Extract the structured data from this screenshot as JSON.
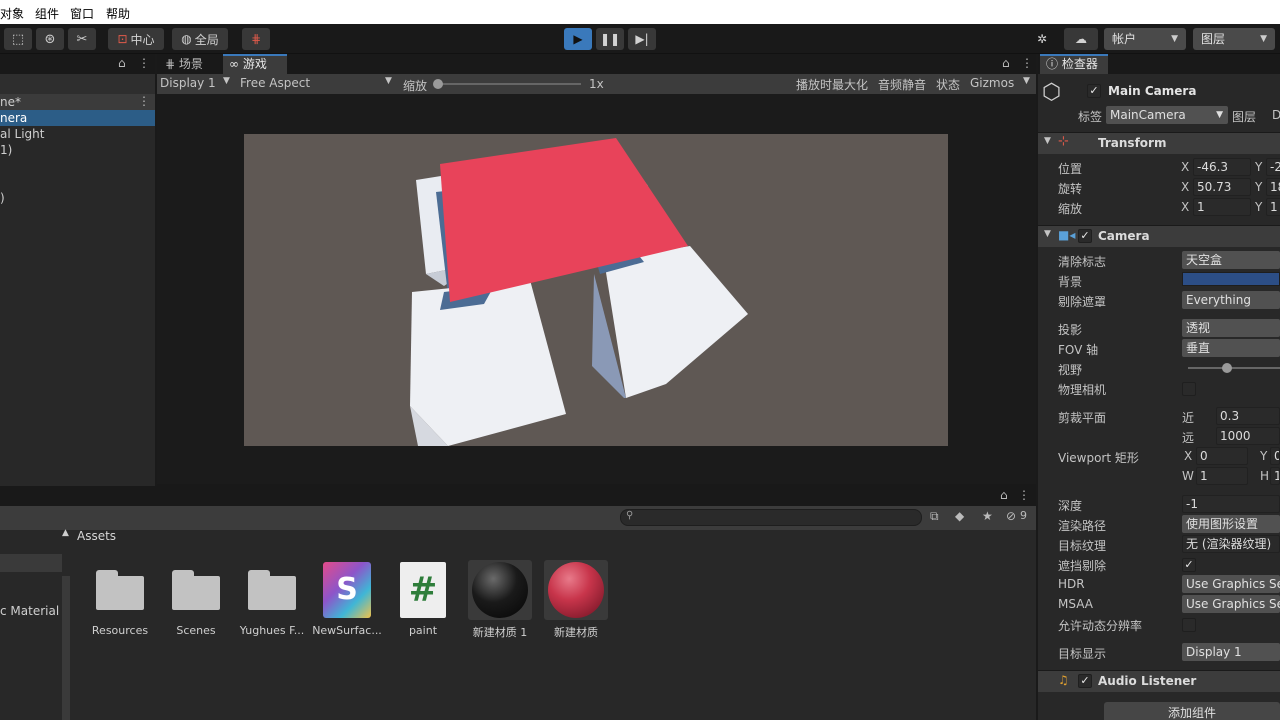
{
  "menu": [
    "对象",
    "组件",
    "窗口",
    "帮助"
  ],
  "toolbar": {
    "pivot_label": "中心",
    "global_label": "全局",
    "account_label": "帐户",
    "layers_label": "图层",
    "accent": "#3a79bb"
  },
  "hierarchy": {
    "scene_label": "ne*",
    "items": [
      "nera",
      "al Light",
      "1)",
      ")"
    ]
  },
  "game": {
    "tabs": [
      "场景",
      "游戏"
    ],
    "display": "Display 1",
    "aspect": "Free Aspect",
    "scale_label": "缩放",
    "scale_value": "1x",
    "maximize_label": "播放时最大化",
    "mute_label": "音频静音",
    "stats_label": "状态",
    "gizmos_label": "Gizmos",
    "background_color": "#5f5854",
    "plane_color": "#e8435a"
  },
  "project": {
    "header": "Assets",
    "left_item": "c Material",
    "eye_count": "9",
    "assets": [
      {
        "label": "Resources",
        "kind": "folder-icon"
      },
      {
        "label": "Scenes",
        "kind": "folder-icon"
      },
      {
        "label": "Yughues F...",
        "kind": "folder-icon"
      },
      {
        "label": "NewSurfac...",
        "kind": "shader-graph-icon",
        "glyph": "S"
      },
      {
        "label": "paint",
        "kind": "csharp-script-icon",
        "glyph": "#"
      },
      {
        "label": "新建材质 1",
        "kind": "material-black-icon"
      },
      {
        "label": "新建材质",
        "kind": "material-red-icon"
      }
    ]
  },
  "inspector": {
    "tab": "检查器",
    "object_name": "Main Camera",
    "tag_label": "标签",
    "tag_value": "MainCamera",
    "layer_label": "图层",
    "layer_value": "D",
    "transform": {
      "title": "Transform",
      "position_label": "位置",
      "rotation_label": "旋转",
      "scale_label": "缩放",
      "position_x": "-46.3",
      "position_y": "-2",
      "rotation_x": "50.73",
      "rotation_y": "18",
      "scale_x": "1",
      "scale_y": "1"
    },
    "camera": {
      "title": "Camera",
      "clear_flags_label": "清除标志",
      "clear_flags_value": "天空盒",
      "background_label": "背景",
      "background_color": "#2c4e86",
      "culling_mask_label": "剔除遮罩",
      "culling_mask_value": "Everything",
      "projection_label": "投影",
      "projection_value": "透视",
      "fov_axis_label": "FOV 轴",
      "fov_axis_value": "垂直",
      "fov_label": "视野",
      "physical_label": "物理相机",
      "clipping_label": "剪裁平面",
      "near_label": "近",
      "near_value": "0.3",
      "far_label": "远",
      "far_value": "1000",
      "viewport_label": "Viewport 矩形",
      "vx_value": "0",
      "vy_value": "0",
      "vw_value": "1",
      "vh_value": "1",
      "depth_label": "深度",
      "depth_value": "-1",
      "render_path_label": "渲染路径",
      "render_path_value": "使用图形设置",
      "target_texture_label": "目标纹理",
      "target_texture_value": "无 (渲染器纹理)",
      "occlusion_label": "遮挡剔除",
      "hdr_label": "HDR",
      "hdr_value": "Use Graphics Se",
      "msaa_label": "MSAA",
      "msaa_value": "Use Graphics Se",
      "dynamic_res_label": "允许动态分辨率",
      "target_display_label": "目标显示",
      "target_display_value": "Display 1"
    },
    "audio_listener": "Audio Listener",
    "add_component": "添加组件"
  }
}
